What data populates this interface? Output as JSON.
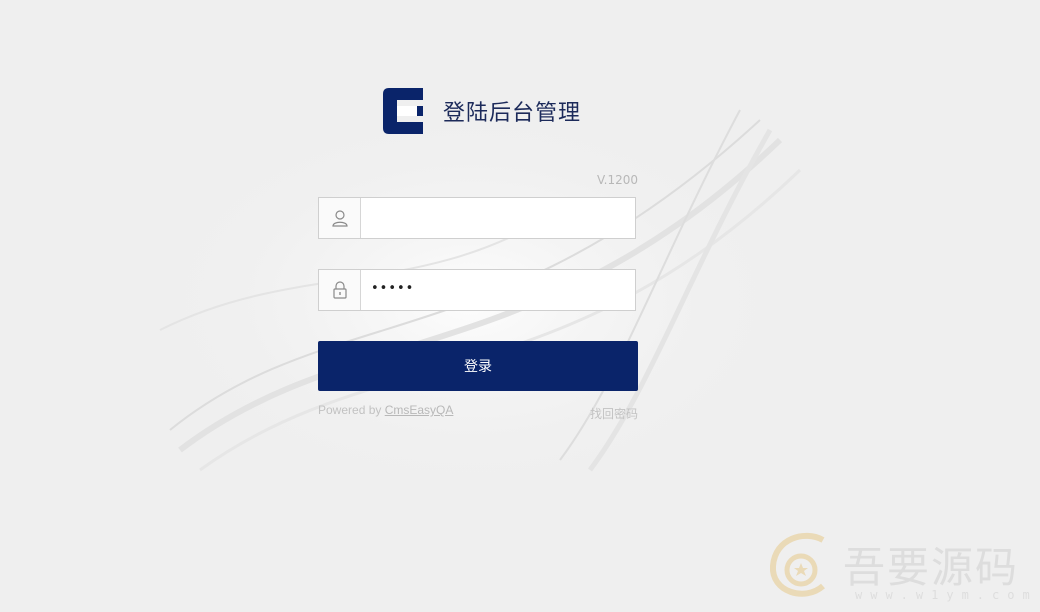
{
  "header": {
    "title": "登陆后台管理",
    "version": "V.1200"
  },
  "form": {
    "username_value": "",
    "username_placeholder": "",
    "password_mask": "•••••",
    "login_label": "登录"
  },
  "footer": {
    "powered_prefix": "Powered by ",
    "powered_link": "CmsEasyQA",
    "forgot_label": "找回密码"
  },
  "watermark": {
    "text": "吾要源码",
    "url": "www.w1ym.com"
  },
  "colors": {
    "brand": "#0a246a",
    "background": "#efefef"
  },
  "icons": {
    "logo": "cmseasy-logo-icon",
    "user": "user-icon",
    "lock": "lock-icon"
  }
}
